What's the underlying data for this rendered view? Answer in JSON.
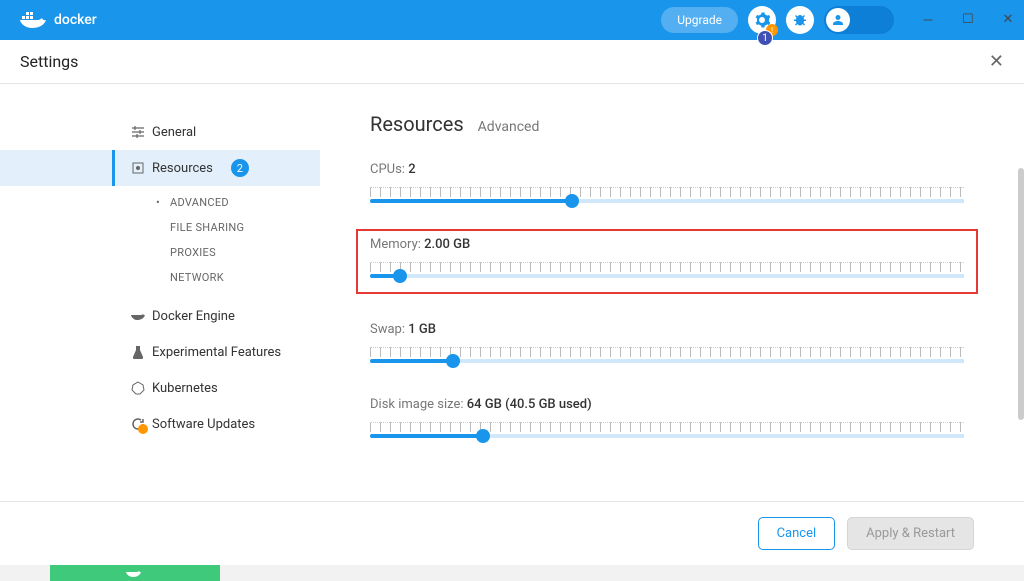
{
  "titlebar": {
    "logo_text": "docker",
    "upgrade": "Upgrade",
    "notif_count": "1"
  },
  "settings_bar": {
    "title": "Settings"
  },
  "sidebar": {
    "items": [
      {
        "label": "General"
      },
      {
        "label": "Resources",
        "badge": "2"
      },
      {
        "label": "Docker Engine"
      },
      {
        "label": "Experimental Features"
      },
      {
        "label": "Kubernetes"
      },
      {
        "label": "Software Updates"
      }
    ],
    "sub_items": [
      {
        "label": "ADVANCED"
      },
      {
        "label": "FILE SHARING"
      },
      {
        "label": "PROXIES"
      },
      {
        "label": "NETWORK"
      }
    ]
  },
  "main": {
    "title": "Resources",
    "subtitle": "Advanced",
    "cpus_label": "CPUs:",
    "cpus_value": "2",
    "memory_label": "Memory:",
    "memory_value": "2.00 GB",
    "swap_label": "Swap:",
    "swap_value": "1 GB",
    "disk_label": "Disk image size:",
    "disk_value": "64 GB (40.5 GB used)"
  },
  "sliders": {
    "cpus_pct": 34,
    "memory_pct": 5,
    "swap_pct": 14,
    "disk_pct": 19
  },
  "footer": {
    "cancel": "Cancel",
    "apply": "Apply & Restart"
  }
}
